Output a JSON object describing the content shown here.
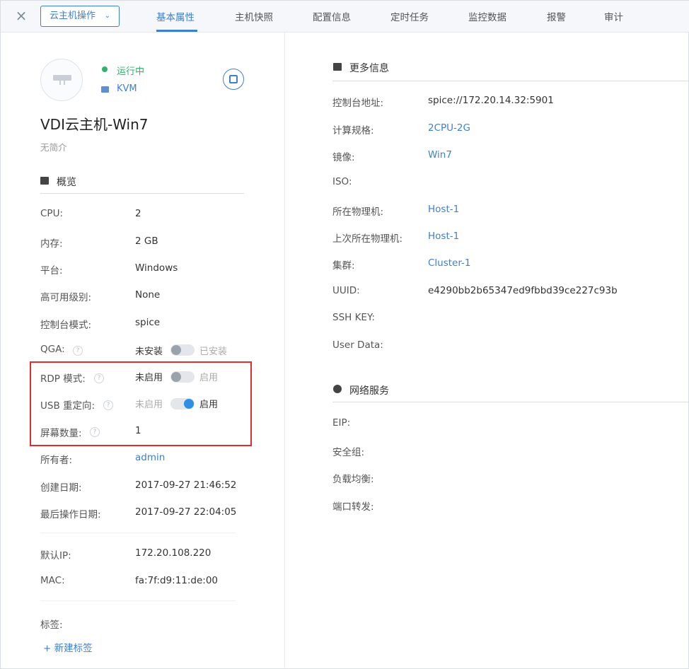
{
  "topbar": {
    "close_icon": "×",
    "action_button": "云主机操作",
    "caret": "⌄",
    "tabs": [
      "基本属性",
      "主机快照",
      "配置信息",
      "定时任务",
      "监控数据",
      "报警",
      "审计"
    ]
  },
  "header": {
    "status": "运行中",
    "hypervisor": "KVM",
    "name": "VDI云主机-Win7",
    "description": "无简介"
  },
  "overview": {
    "title": "概览",
    "cpu_label": "CPU:",
    "cpu_value": "2",
    "memory_label": "内存:",
    "memory_value": "2 GB",
    "platform_label": "平台:",
    "platform_value": "Windows",
    "ha_label": "高可用级别:",
    "ha_value": "None",
    "console_mode_label": "控制台模式:",
    "console_mode_value": "spice",
    "qga_label": "QGA:",
    "qga_off": "未安装",
    "qga_on": "已安装",
    "rdp_label": "RDP 模式:",
    "rdp_off": "未启用",
    "rdp_on": "启用",
    "usb_label": "USB 重定向:",
    "usb_off": "未启用",
    "usb_on": "启用",
    "screens_label": "屏幕数量:",
    "screens_value": "1",
    "owner_label": "所有者:",
    "owner_value": "admin",
    "created_label": "创建日期:",
    "created_value": "2017-09-27 21:46:52",
    "last_op_label": "最后操作日期:",
    "last_op_value": "2017-09-27 22:04:05",
    "ip_label": "默认IP:",
    "ip_value": "172.20.108.220",
    "mac_label": "MAC:",
    "mac_value": "fa:7f:d9:11:de:00",
    "tags_label": "标签:",
    "add_tag": "+ 新建标签",
    "help_glyph": "?"
  },
  "more_info": {
    "title": "更多信息",
    "console_addr_label": "控制台地址:",
    "console_addr_value": "spice://172.20.14.32:5901",
    "spec_label": "计算规格:",
    "spec_value": "2CPU-2G",
    "image_label": "镜像:",
    "image_value": "Win7",
    "iso_label": "ISO:",
    "host_label": "所在物理机:",
    "host_value": "Host-1",
    "last_host_label": "上次所在物理机:",
    "last_host_value": "Host-1",
    "cluster_label": "集群:",
    "cluster_value": "Cluster-1",
    "uuid_label": "UUID:",
    "uuid_value": "e4290bb2b65347ed9fbbd39ce227c93b",
    "ssh_label": "SSH KEY:",
    "userdata_label": "User Data:"
  },
  "network": {
    "title": "网络服务",
    "eip_label": "EIP:",
    "security_group_label": "安全组:",
    "lb_label": "负载均衡:",
    "port_forward_label": "端口转发:"
  },
  "colors": {
    "accent": "#3f7fcf",
    "running": "#2fb26b",
    "highlight": "#e12d2d"
  }
}
